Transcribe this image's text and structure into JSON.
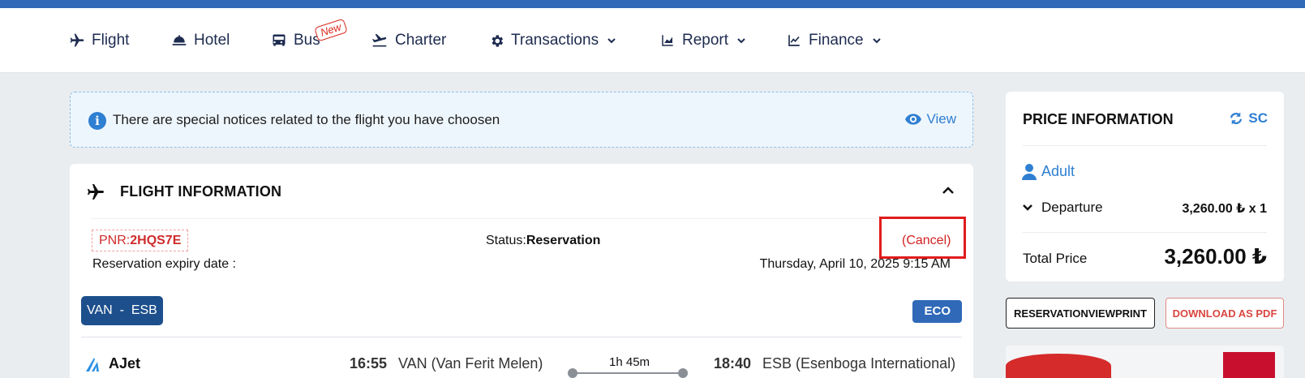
{
  "nav": {
    "items": [
      {
        "label": "Flight",
        "icon": "plane-icon"
      },
      {
        "label": "Hotel",
        "icon": "bell-icon"
      },
      {
        "label": "Bus",
        "icon": "bus-icon"
      },
      {
        "label": "Charter",
        "icon": "plane-departure-icon"
      },
      {
        "label": "Transactions",
        "icon": "gear-icon"
      },
      {
        "label": "Report",
        "icon": "area-chart-icon"
      },
      {
        "label": "Finance",
        "icon": "line-chart-icon"
      }
    ],
    "new_badge": "New"
  },
  "notice": {
    "text": "There are special notices related to the flight you have choosen",
    "view_label": "View"
  },
  "flight_info": {
    "title": "FLIGHT INFORMATION",
    "pnr_label": "PNR:",
    "pnr_value": "2HQS7E",
    "status_label": "Status:",
    "status_value": "Reservation",
    "cancel_label": "(Cancel)",
    "expiry_label": "Reservation expiry date :",
    "expiry_value": "Thursday, April 10, 2025 9:15 AM",
    "route": "VAN  -  ESB",
    "cabin": "ECO",
    "segment": {
      "airline": "AJet",
      "dep_time": "16:55",
      "dep_airport": "VAN (Van Ferit Melen)",
      "duration": "1h 45m",
      "arr_time": "18:40",
      "arr_airport": "ESB (Esenboga International)"
    }
  },
  "price_info": {
    "title": "PRICE INFORMATION",
    "refresh_label": "SC",
    "passenger_type": "Adult",
    "departure_label": "Departure",
    "departure_value": "3,260.00 ₺ x 1",
    "total_label": "Total Price",
    "total_value": "3,260.00 ₺"
  },
  "actions": {
    "print_label": "RESERVATIONVIEWPRINT",
    "pdf_label": "DOWNLOAD AS PDF"
  },
  "colors": {
    "brand_blue": "#2f69b8",
    "cancel_red": "#e01c1c",
    "link_blue": "#2f7fd2"
  }
}
